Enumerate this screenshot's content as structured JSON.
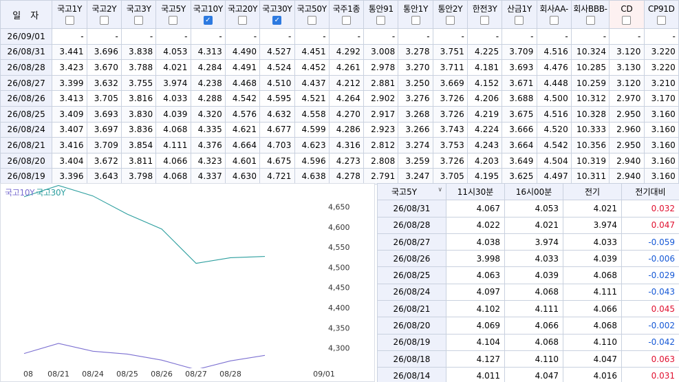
{
  "main_grid": {
    "date_header": "일자",
    "columns": [
      {
        "label": "국고1Y",
        "checked": false
      },
      {
        "label": "국고2Y",
        "checked": false
      },
      {
        "label": "국고3Y",
        "checked": false
      },
      {
        "label": "국고5Y",
        "checked": false
      },
      {
        "label": "국고10Y",
        "checked": true
      },
      {
        "label": "국고20Y",
        "checked": false
      },
      {
        "label": "국고30Y",
        "checked": true
      },
      {
        "label": "국고50Y",
        "checked": false
      },
      {
        "label": "국주1종",
        "checked": false
      },
      {
        "label": "통안91",
        "checked": false
      },
      {
        "label": "통안1Y",
        "checked": false
      },
      {
        "label": "통안2Y",
        "checked": false
      },
      {
        "label": "한전3Y",
        "checked": false
      },
      {
        "label": "산금1Y",
        "checked": false
      },
      {
        "label": "회사AA-",
        "checked": false
      },
      {
        "label": "회사BBB-",
        "checked": false
      },
      {
        "label": "CD",
        "checked": false
      },
      {
        "label": "CP91D",
        "checked": false
      }
    ],
    "rows": [
      {
        "date": "26/09/01",
        "values": [
          "-",
          "-",
          "-",
          "-",
          "-",
          "-",
          "-",
          "-",
          "-",
          "-",
          "-",
          "-",
          "-",
          "-",
          "-",
          "-",
          "-",
          "-"
        ]
      },
      {
        "date": "26/08/31",
        "values": [
          "3.441",
          "3.696",
          "3.838",
          "4.053",
          "4.313",
          "4.490",
          "4.527",
          "4.451",
          "4.292",
          "3.008",
          "3.278",
          "3.751",
          "4.225",
          "3.709",
          "4.516",
          "10.324",
          "3.120",
          "3.220"
        ]
      },
      {
        "date": "26/08/28",
        "values": [
          "3.423",
          "3.670",
          "3.788",
          "4.021",
          "4.284",
          "4.491",
          "4.524",
          "4.452",
          "4.261",
          "2.978",
          "3.270",
          "3.711",
          "4.181",
          "3.693",
          "4.476",
          "10.285",
          "3.130",
          "3.220"
        ]
      },
      {
        "date": "26/08/27",
        "values": [
          "3.399",
          "3.632",
          "3.755",
          "3.974",
          "4.238",
          "4.468",
          "4.510",
          "4.437",
          "4.212",
          "2.881",
          "3.250",
          "3.669",
          "4.152",
          "3.671",
          "4.448",
          "10.259",
          "3.120",
          "3.210"
        ]
      },
      {
        "date": "26/08/26",
        "values": [
          "3.413",
          "3.705",
          "3.816",
          "4.033",
          "4.288",
          "4.542",
          "4.595",
          "4.521",
          "4.264",
          "2.902",
          "3.276",
          "3.726",
          "4.206",
          "3.688",
          "4.500",
          "10.312",
          "2.970",
          "3.170"
        ]
      },
      {
        "date": "26/08/25",
        "values": [
          "3.409",
          "3.693",
          "3.830",
          "4.039",
          "4.320",
          "4.576",
          "4.632",
          "4.558",
          "4.270",
          "2.917",
          "3.268",
          "3.726",
          "4.219",
          "3.675",
          "4.516",
          "10.328",
          "2.950",
          "3.160"
        ]
      },
      {
        "date": "26/08/24",
        "values": [
          "3.407",
          "3.697",
          "3.836",
          "4.068",
          "4.335",
          "4.621",
          "4.677",
          "4.599",
          "4.286",
          "2.923",
          "3.266",
          "3.743",
          "4.224",
          "3.666",
          "4.520",
          "10.333",
          "2.960",
          "3.160"
        ]
      },
      {
        "date": "26/08/21",
        "values": [
          "3.416",
          "3.709",
          "3.854",
          "4.111",
          "4.376",
          "4.664",
          "4.703",
          "4.623",
          "4.316",
          "2.812",
          "3.274",
          "3.753",
          "4.243",
          "3.664",
          "4.542",
          "10.356",
          "2.950",
          "3.160"
        ]
      },
      {
        "date": "26/08/20",
        "values": [
          "3.404",
          "3.672",
          "3.811",
          "4.066",
          "4.323",
          "4.601",
          "4.675",
          "4.596",
          "4.273",
          "2.808",
          "3.259",
          "3.726",
          "4.203",
          "3.649",
          "4.504",
          "10.319",
          "2.940",
          "3.160"
        ]
      },
      {
        "date": "26/08/19",
        "values": [
          "3.396",
          "3.643",
          "3.798",
          "4.068",
          "4.337",
          "4.630",
          "4.721",
          "4.638",
          "4.278",
          "2.791",
          "3.247",
          "3.705",
          "4.195",
          "3.625",
          "4.497",
          "10.311",
          "2.940",
          "3.160"
        ]
      }
    ]
  },
  "chart_data": {
    "type": "line",
    "legend": [
      "국고10Y",
      "국고30Y"
    ],
    "x": [
      "08",
      "08/21",
      "08/24",
      "08/25",
      "08/26",
      "08/27",
      "08/28",
      "09/01"
    ],
    "y_ticks": [
      "4,650",
      "4,600",
      "4,550",
      "4,500",
      "4,450",
      "4,400",
      "4,350",
      "4,300"
    ],
    "ylim": [
      4.28,
      4.68
    ],
    "series": [
      {
        "name": "국고10Y",
        "color": "#7b6fd1",
        "points": [
          [
            "08",
            4.323
          ],
          [
            "08/21",
            4.376
          ],
          [
            "08/24",
            4.335
          ],
          [
            "08/25",
            4.32
          ],
          [
            "08/26",
            4.288
          ],
          [
            "08/27",
            4.238
          ],
          [
            "08/28",
            4.284
          ],
          [
            "08/31",
            4.313
          ]
        ]
      },
      {
        "name": "국고30Y",
        "color": "#2b9e9e",
        "points": [
          [
            "08",
            4.675
          ],
          [
            "08/21",
            4.703
          ],
          [
            "08/24",
            4.677
          ],
          [
            "08/25",
            4.632
          ],
          [
            "08/26",
            4.595
          ],
          [
            "08/27",
            4.51
          ],
          [
            "08/28",
            4.524
          ],
          [
            "08/31",
            4.527
          ]
        ]
      }
    ]
  },
  "compare": {
    "selector": "국고5Y",
    "headers": [
      "11시30분",
      "16시00분",
      "전기",
      "전기대비"
    ],
    "rows": [
      {
        "date": "26/08/31",
        "v1": "4.067",
        "v2": "4.053",
        "prev": "4.021",
        "diff": "0.032",
        "dir": "up"
      },
      {
        "date": "26/08/28",
        "v1": "4.022",
        "v2": "4.021",
        "prev": "3.974",
        "diff": "0.047",
        "dir": "up"
      },
      {
        "date": "26/08/27",
        "v1": "4.038",
        "v2": "3.974",
        "prev": "4.033",
        "diff": "-0.059",
        "dir": "down"
      },
      {
        "date": "26/08/26",
        "v1": "3.998",
        "v2": "4.033",
        "prev": "4.039",
        "diff": "-0.006",
        "dir": "down"
      },
      {
        "date": "26/08/25",
        "v1": "4.063",
        "v2": "4.039",
        "prev": "4.068",
        "diff": "-0.029",
        "dir": "down"
      },
      {
        "date": "26/08/24",
        "v1": "4.097",
        "v2": "4.068",
        "prev": "4.111",
        "diff": "-0.043",
        "dir": "down"
      },
      {
        "date": "26/08/21",
        "v1": "4.102",
        "v2": "4.111",
        "prev": "4.066",
        "diff": "0.045",
        "dir": "up"
      },
      {
        "date": "26/08/20",
        "v1": "4.069",
        "v2": "4.066",
        "prev": "4.068",
        "diff": "-0.002",
        "dir": "down"
      },
      {
        "date": "26/08/19",
        "v1": "4.104",
        "v2": "4.068",
        "prev": "4.110",
        "diff": "-0.042",
        "dir": "down"
      },
      {
        "date": "26/08/18",
        "v1": "4.127",
        "v2": "4.110",
        "prev": "4.047",
        "diff": "0.063",
        "dir": "up"
      },
      {
        "date": "26/08/14",
        "v1": "4.011",
        "v2": "4.047",
        "prev": "4.016",
        "diff": "0.031",
        "dir": "up"
      }
    ]
  }
}
